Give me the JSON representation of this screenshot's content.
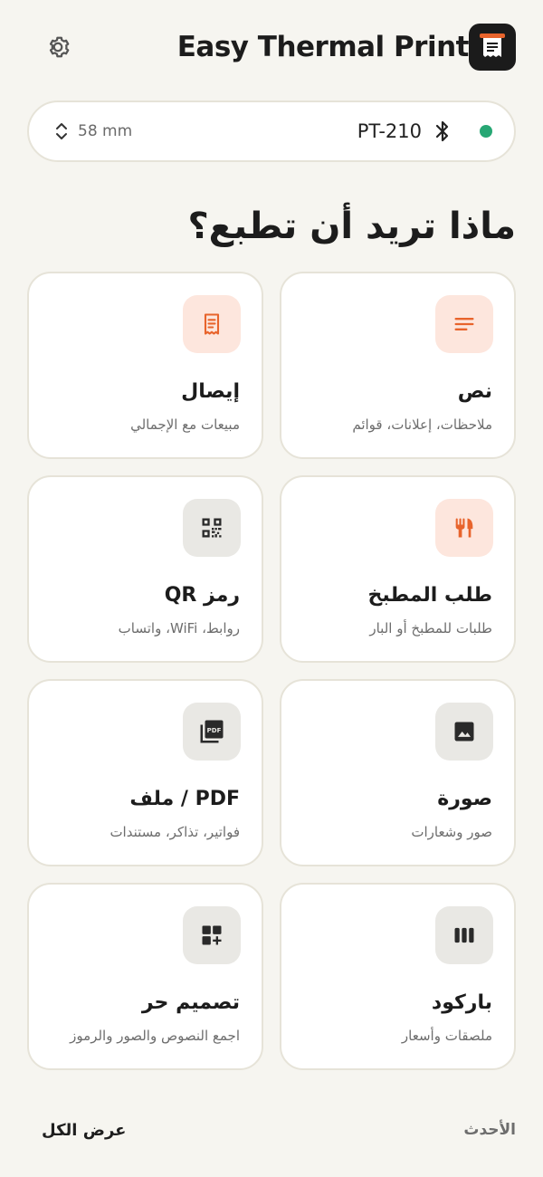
{
  "header": {
    "app_title": "Easy Thermal Print"
  },
  "printer": {
    "paper_size": "58 mm",
    "name": "PT-210",
    "status_color": "#27a774"
  },
  "question": "ماذا تريد أن تطبع؟",
  "cards": [
    {
      "title": "نص",
      "subtitle": "ملاحظات، إعلانات، قوائم",
      "icon": "text-lines-icon"
    },
    {
      "title": "إيصال",
      "subtitle": "مبيعات مع الإجمالي",
      "icon": "receipt-icon"
    },
    {
      "title": "طلب المطبخ",
      "subtitle": "طلبات للمطبخ أو البار",
      "icon": "fork-knife-icon"
    },
    {
      "title": "رمز QR",
      "subtitle": "روابط، WiFi، واتساب",
      "icon": "qr-code-icon"
    },
    {
      "title": "صورة",
      "subtitle": "صور وشعارات",
      "icon": "image-icon"
    },
    {
      "title": "PDF / ملف",
      "subtitle": "فواتير، تذاكر، مستندات",
      "icon": "pdf-icon"
    },
    {
      "title": "باركود",
      "subtitle": "ملصقات وأسعار",
      "icon": "barcode-icon"
    },
    {
      "title": "تصميم حر",
      "subtitle": "اجمع النصوص والصور والرموز",
      "icon": "free-design-icon"
    }
  ],
  "footer": {
    "recent_label": "الأحدث",
    "view_all_label": "عرض الكل"
  },
  "colors": {
    "accent": "#e8642c",
    "background": "#f6f5f0"
  }
}
